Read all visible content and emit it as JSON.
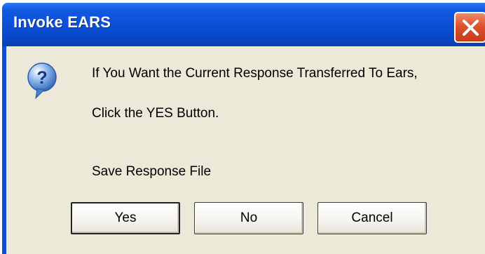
{
  "window": {
    "title": "Invoke EARS"
  },
  "dialog": {
    "icon": "question-icon",
    "message_line1": "If You Want the Current Response Transferred To Ears,",
    "message_line2": "Click the YES Button.",
    "message_line3": "Save Response File"
  },
  "buttons": {
    "yes": "Yes",
    "no": "No",
    "cancel": "Cancel"
  },
  "colors": {
    "titlebar": "#0a4fd6",
    "client_background": "#ece9d8",
    "close_button": "#e0512c"
  }
}
